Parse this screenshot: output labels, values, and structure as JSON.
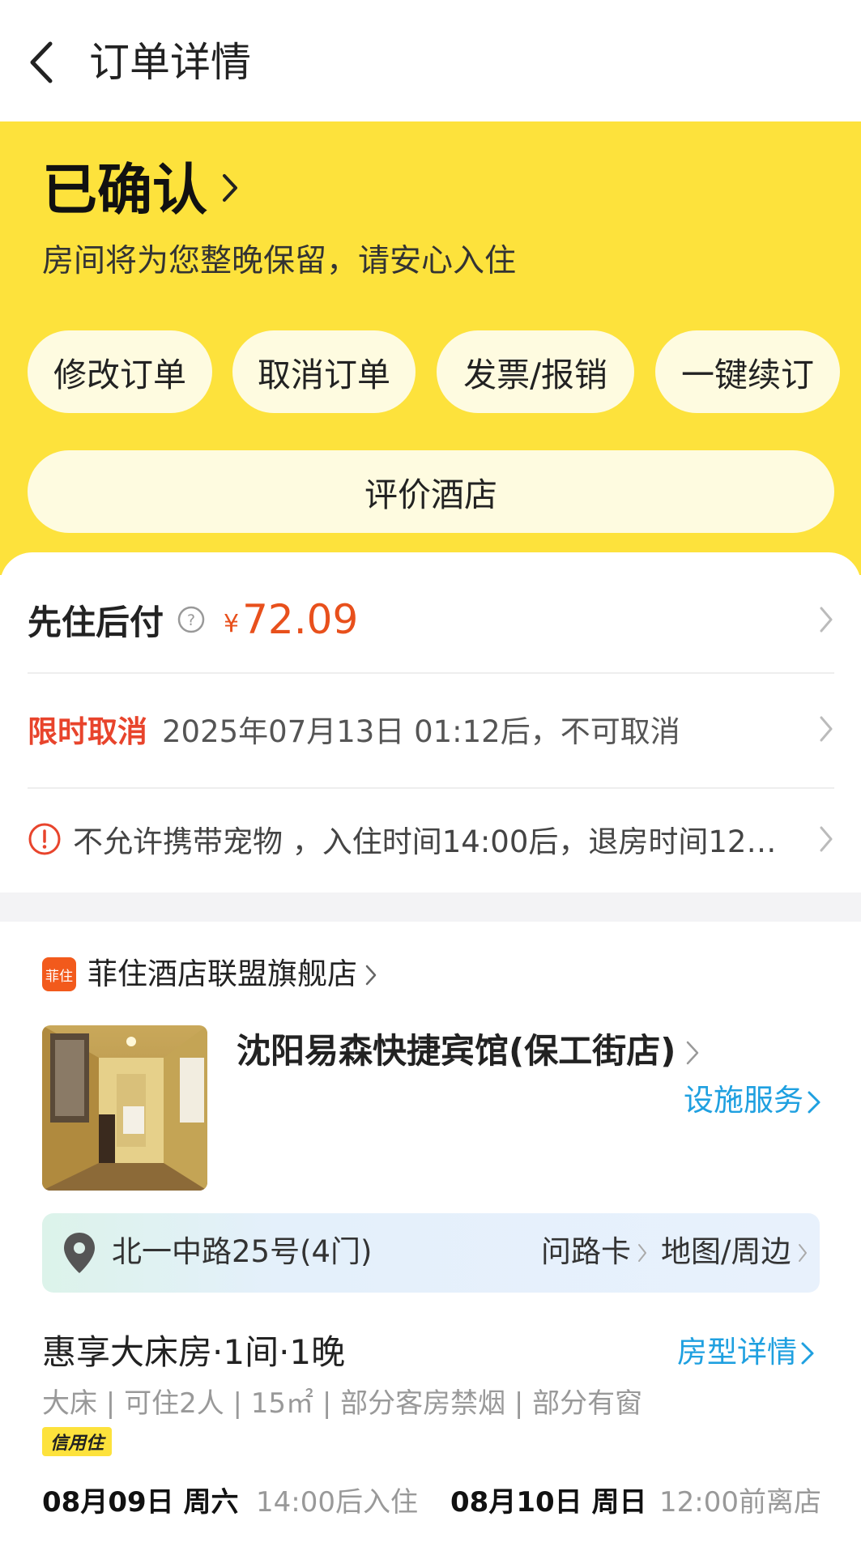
{
  "header": {
    "title": "订单详情"
  },
  "status": {
    "title": "已确认",
    "subtitle": "房间将为您整晚保留，请安心入住",
    "actions": [
      "修改订单",
      "取消订单",
      "发票/报销",
      "一键续订"
    ],
    "review_label": "评价酒店"
  },
  "payment": {
    "label": "先住后付",
    "currency": "¥",
    "amount": "72.09"
  },
  "cancellation": {
    "tag": "限时取消",
    "text": "2025年07月13日 01:12后，不可取消"
  },
  "notice": {
    "text": "不允许携带宠物 ，入住时间14:00后，退房时间12:…"
  },
  "store": {
    "logo_text": "菲住",
    "name": "菲住酒店联盟旗舰店"
  },
  "hotel": {
    "name": "沈阳易森快捷宾馆(保工街店)",
    "facility_link": "设施服务",
    "address": "北一中路25号(4门)",
    "address_links": [
      "问路卡",
      "地图/周边"
    ]
  },
  "room": {
    "name": "惠享大床房·1间·1晚",
    "detail_link": "房型详情",
    "specs": "大床 | 可住2人 | 15㎡ | 部分客房禁烟 | 部分有窗",
    "badge": "信用住"
  },
  "stay": {
    "checkin_date": "08月09日 周六",
    "checkin_note": "14:00后入住",
    "checkout_date": "08月10日 周日",
    "checkout_note": "12:00前离店"
  },
  "colors": {
    "brand_yellow": "#fde23c",
    "price_orange": "#e8501c",
    "link_blue": "#1fa0e0",
    "warn_red": "#e8442c"
  }
}
